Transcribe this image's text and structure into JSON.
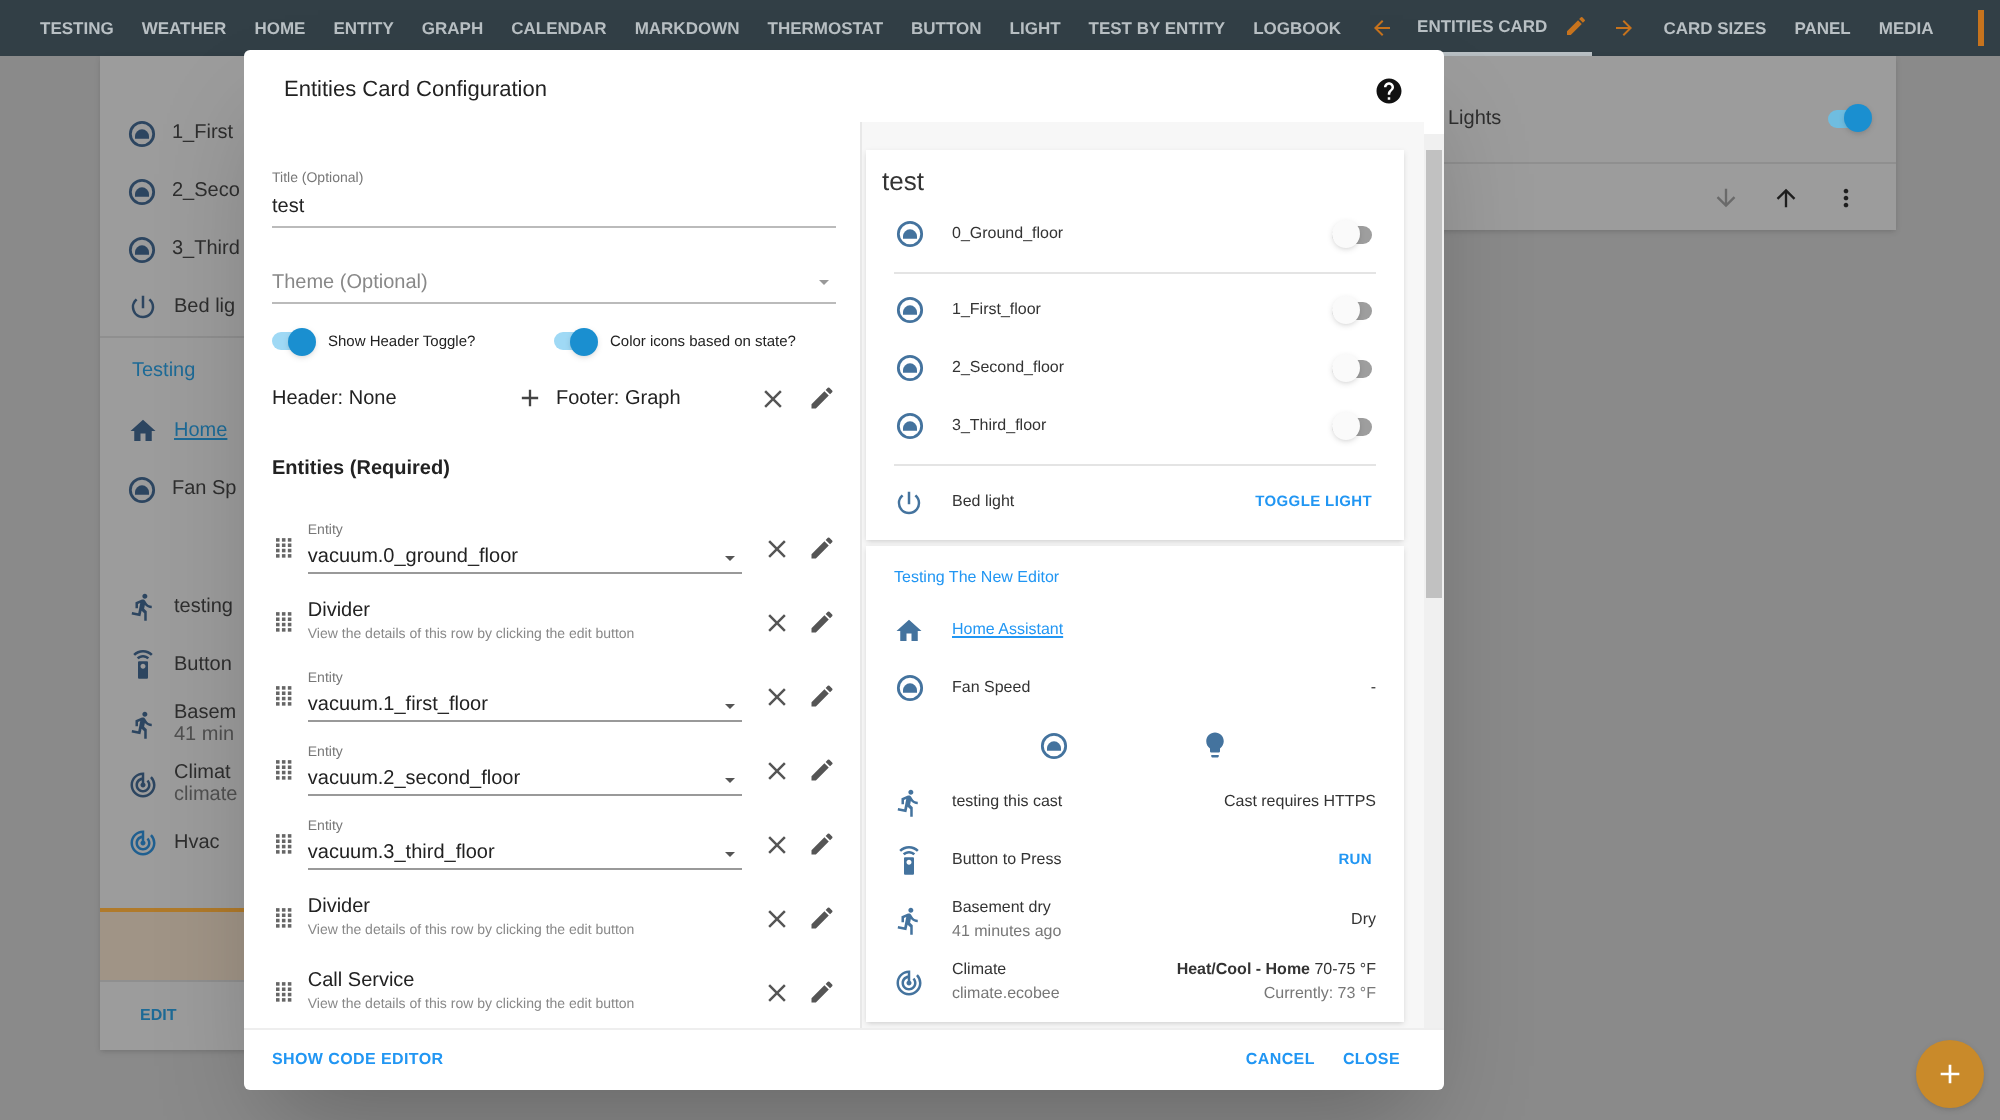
{
  "nav": {
    "tabs": [
      {
        "label": "TESTING",
        "selected": false
      },
      {
        "label": "WEATHER",
        "selected": false
      },
      {
        "label": "HOME",
        "selected": false
      },
      {
        "label": "ENTITY",
        "selected": false
      },
      {
        "label": "GRAPH",
        "selected": false
      },
      {
        "label": "CALENDAR",
        "selected": false
      },
      {
        "label": "MARKDOWN",
        "selected": false
      },
      {
        "label": "THERMOSTAT",
        "selected": false
      },
      {
        "label": "BUTTON",
        "selected": false
      },
      {
        "label": "LIGHT",
        "selected": false
      },
      {
        "label": "TEST BY ENTITY",
        "selected": false
      },
      {
        "label": "LOGBOOK",
        "selected": false
      },
      {
        "label": "ENTITIES CARD",
        "selected": true
      },
      {
        "label": "CARD SIZES",
        "selected": false
      },
      {
        "label": "PANEL",
        "selected": false
      },
      {
        "label": "MEDIA",
        "selected": false
      }
    ]
  },
  "background_card": {
    "rows": [
      {
        "kind": "entity",
        "name": "1_First"
      },
      {
        "kind": "entity",
        "name": "2_Seco"
      },
      {
        "kind": "entity",
        "name": "3_Third"
      },
      {
        "kind": "entity",
        "name": "Bed lig"
      },
      {
        "kind": "section",
        "name": "Testing"
      },
      {
        "kind": "link",
        "name": "Home"
      },
      {
        "kind": "entity",
        "name": "Fan Sp"
      },
      {
        "kind": "spacer"
      },
      {
        "kind": "entity",
        "name": "testing"
      },
      {
        "kind": "entity",
        "name": "Button"
      },
      {
        "kind": "entity",
        "name": "Basem",
        "secondary": "41 min"
      },
      {
        "kind": "entity",
        "name": "Climat",
        "secondary": "climate"
      },
      {
        "kind": "entity",
        "name": "Hvac"
      }
    ],
    "edit_button": "EDIT"
  },
  "background_card_right": {
    "rows": [
      {
        "name": "Lights",
        "on": true
      }
    ]
  },
  "dialog": {
    "title": "Entities Card Configuration",
    "title_field": {
      "label": "Title (Optional)",
      "value": "test"
    },
    "theme_field": {
      "placeholder": "Theme (Optional)"
    },
    "switches": [
      {
        "label": "Show Header Toggle?",
        "on": true
      },
      {
        "label": "Color icons based on state?",
        "on": true
      }
    ],
    "header": "Header: None",
    "footer": "Footer: Graph",
    "entities_heading": "Entities (Required)",
    "entities": [
      {
        "kind": "entity",
        "label": "Entity",
        "value": "vacuum.0_ground_floor"
      },
      {
        "kind": "special",
        "title": "Divider",
        "description": "View the details of this row by clicking the edit button"
      },
      {
        "kind": "entity",
        "label": "Entity",
        "value": "vacuum.1_first_floor"
      },
      {
        "kind": "entity",
        "label": "Entity",
        "value": "vacuum.2_second_floor"
      },
      {
        "kind": "entity",
        "label": "Entity",
        "value": "vacuum.3_third_floor"
      },
      {
        "kind": "special",
        "title": "Divider",
        "description": "View the details of this row by clicking the edit button"
      },
      {
        "kind": "special",
        "title": "Call Service",
        "description": "View the details of this row by clicking the edit button"
      }
    ],
    "preview": {
      "cards": [
        {
          "title": "test",
          "rows": [
            {
              "kind": "toggle",
              "name": "0_Ground_floor",
              "on": false
            },
            {
              "kind": "divider"
            },
            {
              "kind": "toggle",
              "name": "1_First_floor",
              "on": false
            },
            {
              "kind": "toggle",
              "name": "2_Second_floor",
              "on": false
            },
            {
              "kind": "toggle",
              "name": "3_Third_floor",
              "on": false
            },
            {
              "kind": "divider"
            },
            {
              "kind": "button",
              "name": "Bed light",
              "action": "TOGGLE LIGHT"
            }
          ]
        },
        {
          "rows": [
            {
              "kind": "section",
              "label": "Testing The New Editor"
            },
            {
              "kind": "link",
              "name": "Home Assistant"
            },
            {
              "kind": "state",
              "name": "Fan Speed",
              "state": "-"
            },
            {
              "kind": "buttons"
            },
            {
              "kind": "state",
              "name": "testing this cast",
              "state": "Cast requires HTTPS"
            },
            {
              "kind": "button",
              "name": "Button to Press",
              "action": "RUN"
            },
            {
              "kind": "state",
              "name": "Basement dry",
              "secondary": "41 minutes ago",
              "state": "Dry"
            },
            {
              "kind": "state",
              "name": "Climate",
              "secondary": "climate.ecobee",
              "state": "**Heat/Cool - Home** 70-75 °F",
              "state_secondary": "Currently: 73 °F"
            }
          ]
        }
      ]
    },
    "buttons": {
      "code": "SHOW CODE EDITOR",
      "cancel": "CANCEL",
      "close": "CLOSE"
    }
  }
}
